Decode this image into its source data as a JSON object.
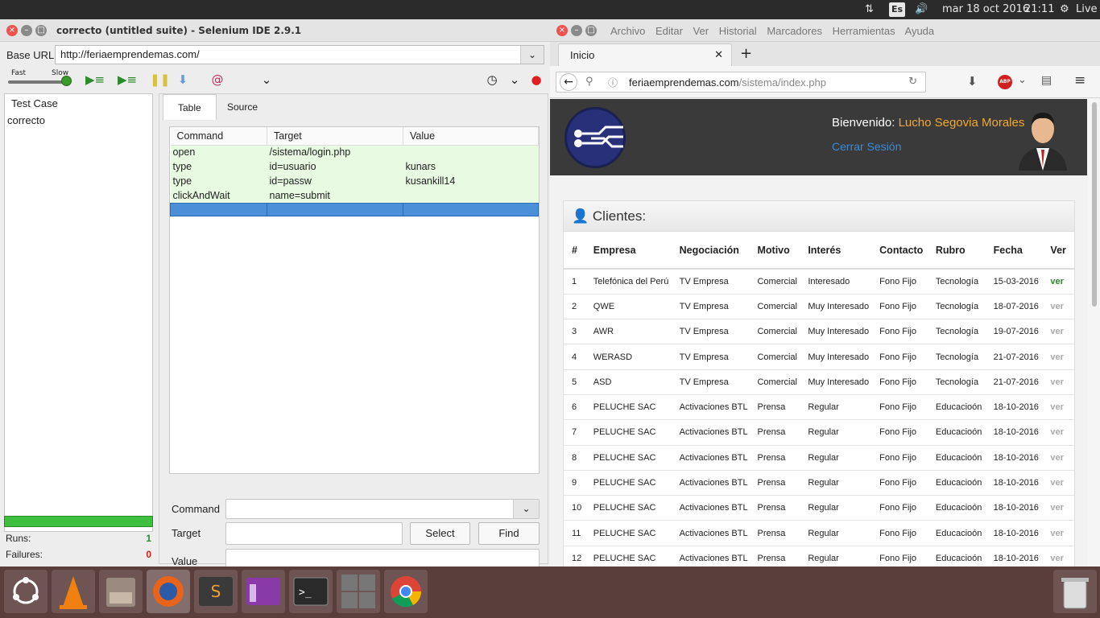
{
  "topbar": {
    "keyboard_layout": "Es",
    "datetime": "mar 18 oct 2016",
    "time": "21:11",
    "session_label": "Live"
  },
  "selenium": {
    "title": "correcto (untitled suite) - Selenium IDE 2.9.1",
    "base_url_label": "Base URL",
    "base_url": "http://feriaemprendemas.com/",
    "speed_fast": "Fast",
    "speed_slow": "Slow",
    "testcase_header": "Test Case",
    "testcases": [
      "correcto"
    ],
    "tabs": [
      "Table",
      "Source"
    ],
    "columns": [
      "Command",
      "Target",
      "Value"
    ],
    "commands": [
      {
        "command": "open",
        "target": "/sistema/login.php",
        "value": ""
      },
      {
        "command": "type",
        "target": "id=usuario",
        "value": "kunars"
      },
      {
        "command": "type",
        "target": "id=passw",
        "value": "kusankill14"
      },
      {
        "command": "clickAndWait",
        "target": "name=submit",
        "value": ""
      }
    ],
    "command_label": "Command",
    "target_label": "Target",
    "value_label": "Value",
    "select_button": "Select",
    "find_button": "Find",
    "runs_label": "Runs:",
    "runs": "1",
    "failures_label": "Failures:",
    "failures": "0",
    "progress": 1.0
  },
  "firefox": {
    "menu": [
      "Archivo",
      "Editar",
      "Ver",
      "Historial",
      "Marcadores",
      "Herramientas",
      "Ayuda"
    ],
    "tab_title": "Inicio",
    "url_host": "feriaemprendemas.com",
    "url_path": "/sistema/index.php",
    "adblock_label": "ABP"
  },
  "site": {
    "welcome_label": "Bienvenido:",
    "user_name": "Lucho Segovia Morales",
    "logout": "Cerrar Sesión",
    "panel_title": "Clientes:",
    "columns": [
      "#",
      "Empresa",
      "Negociación",
      "Motivo",
      "Interés",
      "Contacto",
      "Rubro",
      "Fecha",
      "Ver"
    ],
    "rows": [
      [
        "1",
        "Telefónica del Perú",
        "TV Empresa",
        "Comercial",
        "Interesado",
        "Fono Fijo",
        "Tecnología",
        "15-03-2016",
        "ver"
      ],
      [
        "2",
        "QWE",
        "TV Empresa",
        "Comercial",
        "Muy Interesado",
        "Fono Fijo",
        "Tecnología",
        "18-07-2016",
        "ver"
      ],
      [
        "3",
        "AWR",
        "TV Empresa",
        "Comercial",
        "Muy Interesado",
        "Fono Fijo",
        "Tecnología",
        "19-07-2016",
        "ver"
      ],
      [
        "4",
        "WERASD",
        "TV Empresa",
        "Comercial",
        "Muy Interesado",
        "Fono Fijo",
        "Tecnología",
        "21-07-2016",
        "ver"
      ],
      [
        "5",
        "ASD",
        "TV Empresa",
        "Comercial",
        "Muy Interesado",
        "Fono Fijo",
        "Tecnología",
        "21-07-2016",
        "ver"
      ],
      [
        "6",
        "PELUCHE SAC",
        "Activaciones BTL",
        "Prensa",
        "Regular",
        "Fono Fijo",
        "Educacioón",
        "18-10-2016",
        "ver"
      ],
      [
        "7",
        "PELUCHE SAC",
        "Activaciones BTL",
        "Prensa",
        "Regular",
        "Fono Fijo",
        "Educacioón",
        "18-10-2016",
        "ver"
      ],
      [
        "8",
        "PELUCHE SAC",
        "Activaciones BTL",
        "Prensa",
        "Regular",
        "Fono Fijo",
        "Educacioón",
        "18-10-2016",
        "ver"
      ],
      [
        "9",
        "PELUCHE SAC",
        "Activaciones BTL",
        "Prensa",
        "Regular",
        "Fono Fijo",
        "Educacioón",
        "18-10-2016",
        "ver"
      ],
      [
        "10",
        "PELUCHE SAC",
        "Activaciones BTL",
        "Prensa",
        "Regular",
        "Fono Fijo",
        "Educacioón",
        "18-10-2016",
        "ver"
      ],
      [
        "11",
        "PELUCHE SAC",
        "Activaciones BTL",
        "Prensa",
        "Regular",
        "Fono Fijo",
        "Educacioón",
        "18-10-2016",
        "ver"
      ],
      [
        "12",
        "PELUCHE SAC",
        "Activaciones BTL",
        "Prensa",
        "Regular",
        "Fono Fijo",
        "Educacioón",
        "18-10-2016",
        "ver"
      ]
    ]
  },
  "launcher": [
    "ubuntu-icon",
    "vlc-icon",
    "files-icon",
    "firefox-icon",
    "sublime-icon",
    "app-icon",
    "terminal-icon",
    "workspaces-icon",
    "chrome-icon",
    "trash-icon"
  ],
  "colors": {
    "accent_green": "#3fbf3f",
    "selection_blue": "#4a8fd8",
    "username_orange": "#f0a830",
    "link_blue": "#3a8ad8"
  }
}
